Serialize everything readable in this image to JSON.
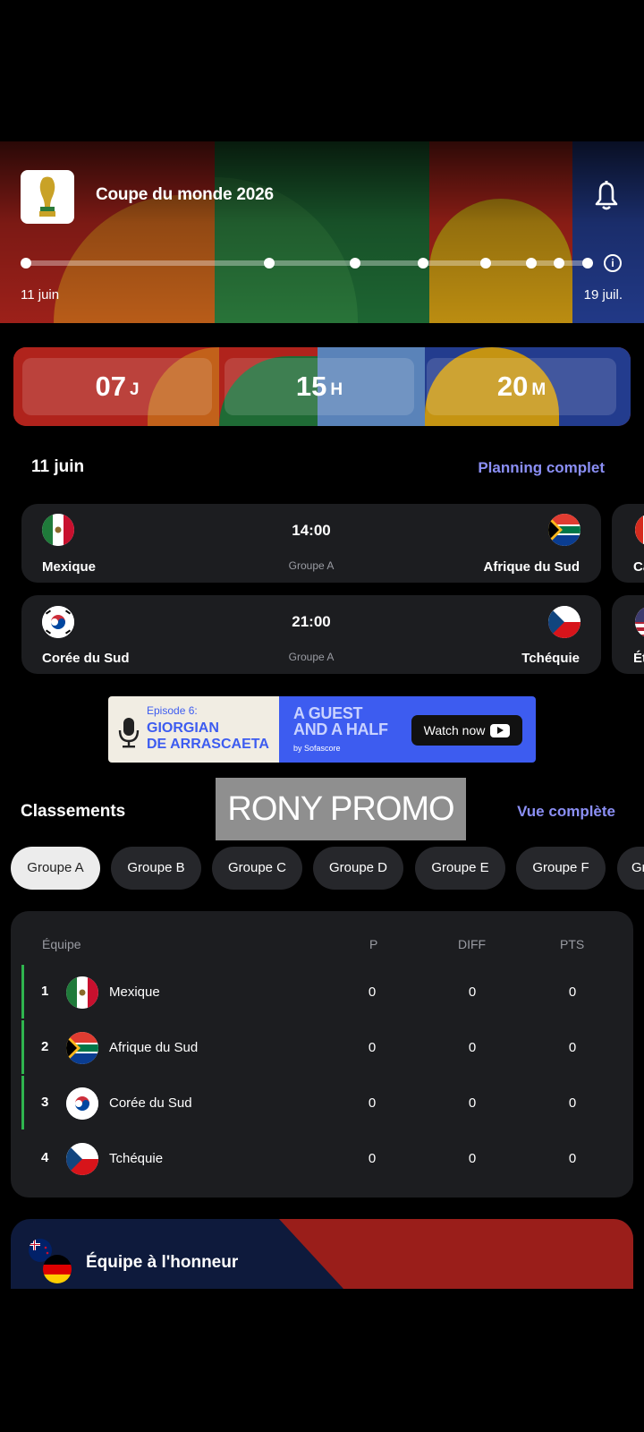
{
  "header": {
    "title": "Coupe du monde 2026",
    "timeline_start": "11 juin",
    "timeline_end": "19 juil.",
    "info_icon": "i"
  },
  "countdown": {
    "days": "07",
    "days_unit": "J",
    "hours": "15",
    "hours_unit": "H",
    "minutes": "20",
    "minutes_unit": "M"
  },
  "schedule": {
    "date": "11 juin",
    "full_link": "Planning complet",
    "matches": [
      {
        "home": "Mexique",
        "away": "Afrique du Sud",
        "time": "14:00",
        "group": "Groupe A"
      },
      {
        "home": "Corée du Sud",
        "away": "Tchéquie",
        "time": "21:00",
        "group": "Groupe A"
      }
    ],
    "next_card_labels": [
      "Ca",
      "Ét"
    ]
  },
  "ad": {
    "episode": "Episode 6:",
    "guest_line1": "GIORGIAN",
    "guest_line2": "DE ARRASCAETA",
    "show_line1": "A GUEST",
    "show_line2": "AND A HALF",
    "by": "by Sofascore",
    "cta": "Watch now"
  },
  "promo_overlay": "RONY PROMO",
  "standings": {
    "title": "Classements",
    "full_link": "Vue complète",
    "groups": [
      "Groupe A",
      "Groupe B",
      "Groupe C",
      "Groupe D",
      "Groupe E",
      "Groupe F",
      "Gr"
    ],
    "active_group": "Groupe A",
    "headers": {
      "team": "Équipe",
      "played": "P",
      "diff": "DIFF",
      "points": "PTS"
    },
    "rows": [
      {
        "pos": "1",
        "team": "Mexique",
        "p": "0",
        "diff": "0",
        "pts": "0"
      },
      {
        "pos": "2",
        "team": "Afrique du Sud",
        "p": "0",
        "diff": "0",
        "pts": "0"
      },
      {
        "pos": "3",
        "team": "Corée du Sud",
        "p": "0",
        "diff": "0",
        "pts": "0"
      },
      {
        "pos": "4",
        "team": "Tchéquie",
        "p": "0",
        "diff": "0",
        "pts": "0"
      }
    ]
  },
  "featured_team": {
    "title": "Équipe à l'honneur"
  },
  "colors": {
    "accent_link": "#8b8ff5",
    "qualify_bar": "#2fb54e",
    "card_bg": "#1c1d20"
  }
}
